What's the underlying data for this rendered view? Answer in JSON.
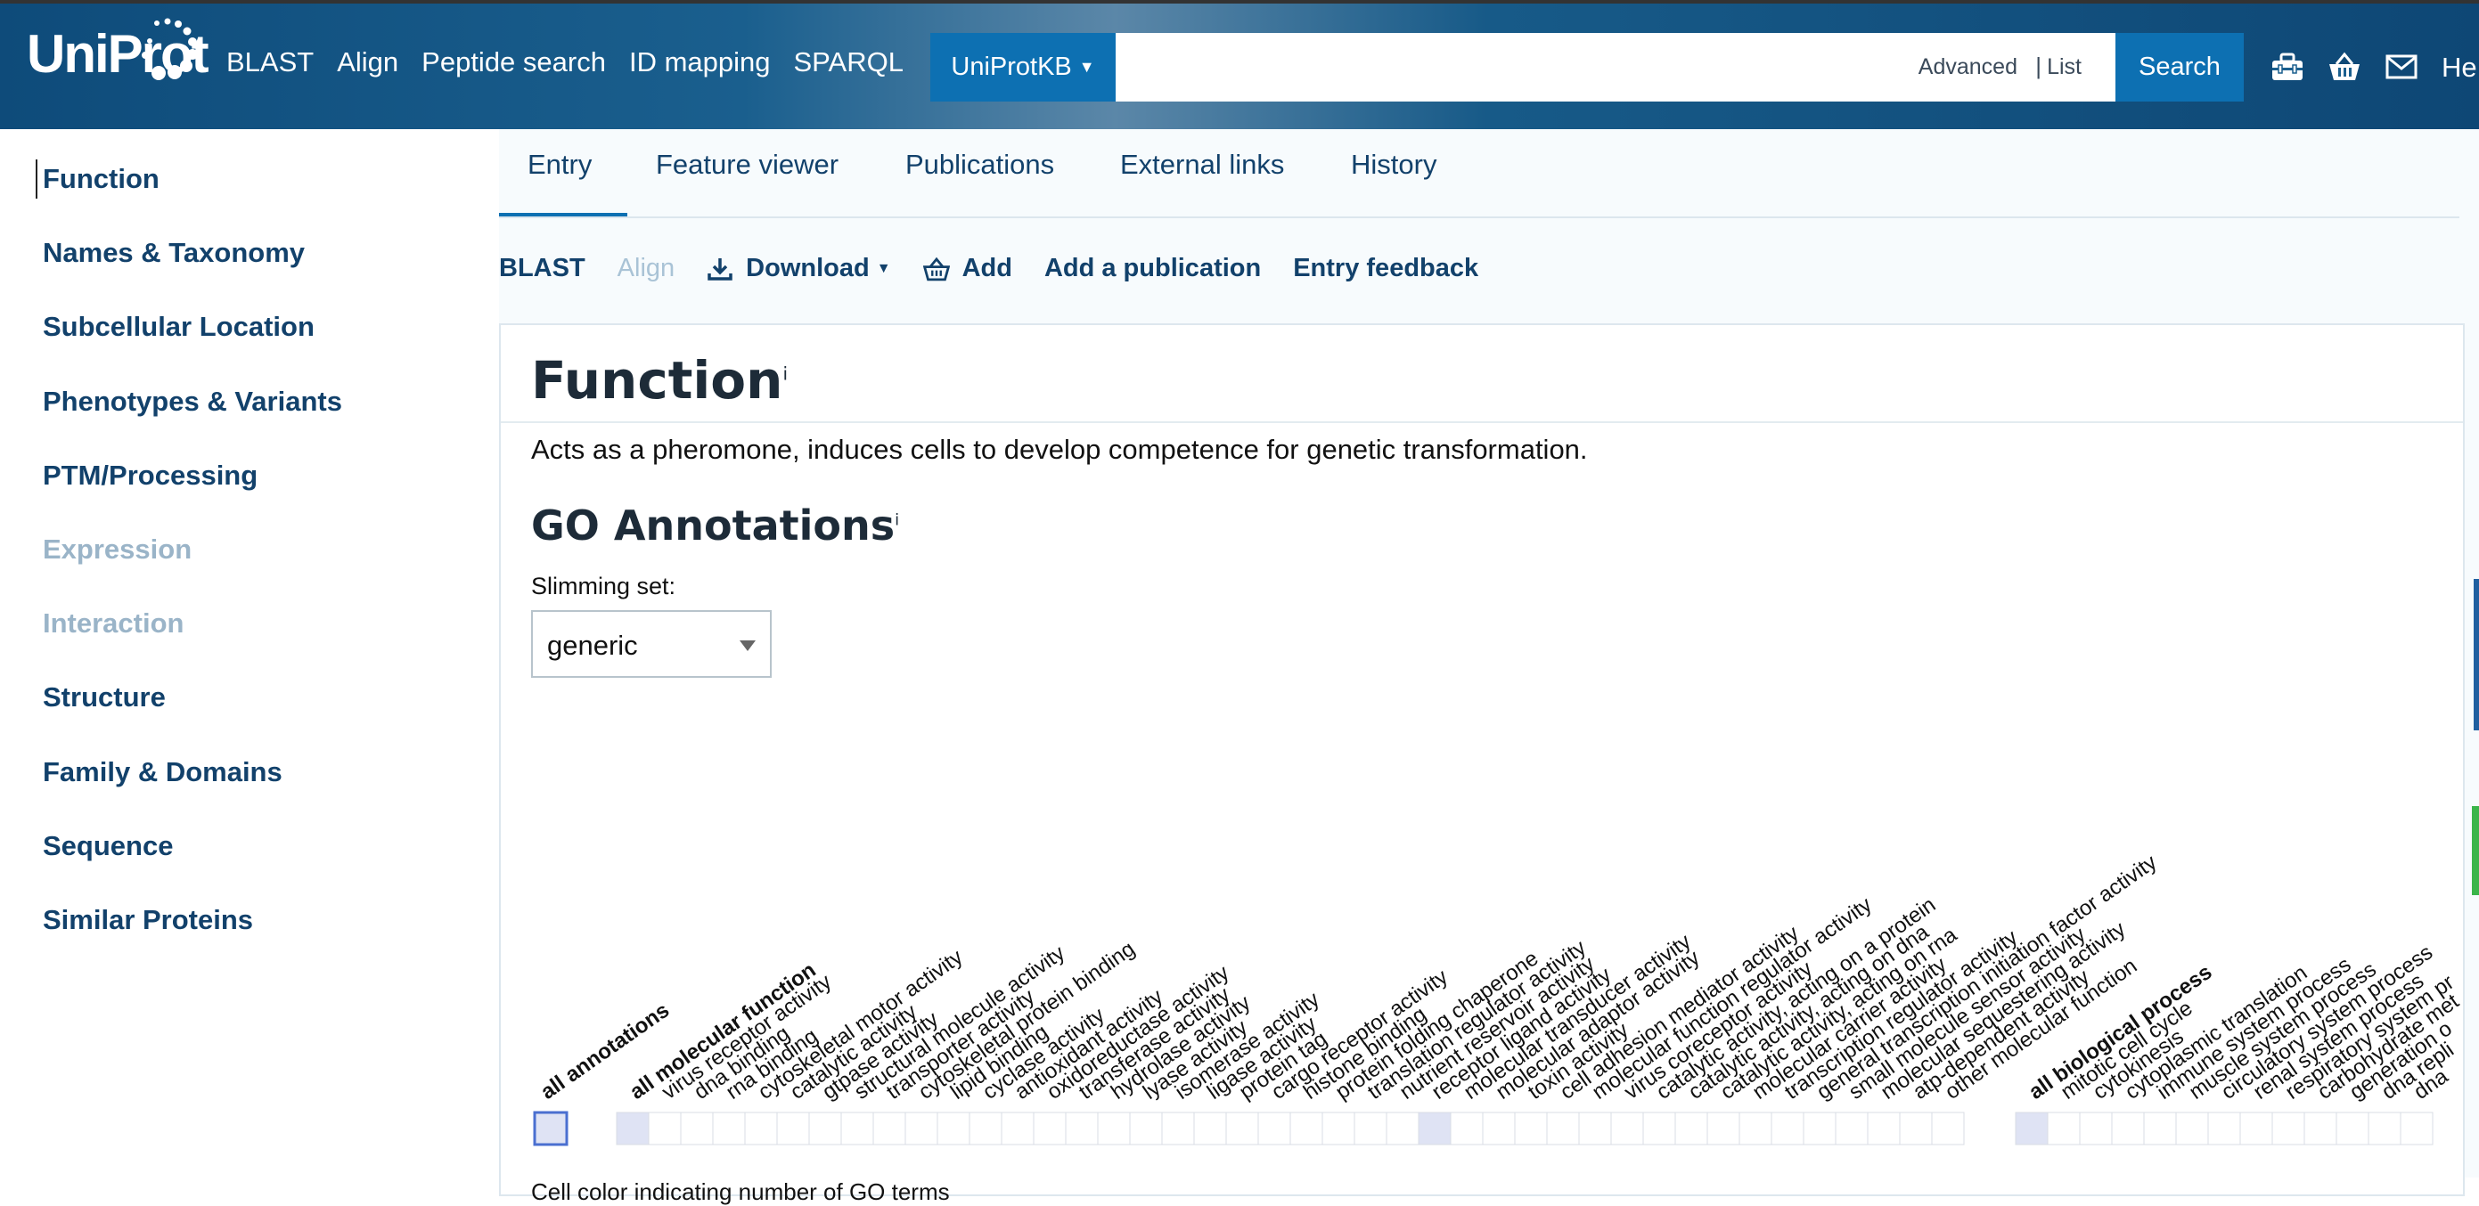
{
  "header": {
    "logo_text": "UniProt",
    "nav": [
      "BLAST",
      "Align",
      "Peptide search",
      "ID mapping",
      "SPARQL"
    ],
    "database": "UniProtKB",
    "search_placeholder": "",
    "advanced_label": "Advanced",
    "separator": "|",
    "list_label": "List",
    "search_label": "Search",
    "help_label": "He",
    "icons": [
      "toolbox-icon",
      "basket-icon",
      "mail-icon"
    ]
  },
  "sidebar": {
    "items": [
      {
        "label": "Function",
        "enabled": true
      },
      {
        "label": "Names & Taxonomy",
        "enabled": true
      },
      {
        "label": "Subcellular Location",
        "enabled": true
      },
      {
        "label": "Phenotypes & Variants",
        "enabled": true
      },
      {
        "label": "PTM/Processing",
        "enabled": true
      },
      {
        "label": "Expression",
        "enabled": false
      },
      {
        "label": "Interaction",
        "enabled": false
      },
      {
        "label": "Structure",
        "enabled": true
      },
      {
        "label": "Family & Domains",
        "enabled": true
      },
      {
        "label": "Sequence",
        "enabled": true
      },
      {
        "label": "Similar Proteins",
        "enabled": true
      }
    ]
  },
  "tabs": [
    "Entry",
    "Feature viewer",
    "Publications",
    "External links",
    "History"
  ],
  "actions": {
    "blast": "BLAST",
    "align": "Align",
    "download": "Download",
    "add": "Add",
    "add_publication": "Add a publication",
    "feedback": "Entry feedback"
  },
  "function_section": {
    "title": "Function",
    "info": "i",
    "description": "Acts as a pheromone, induces cells to develop competence for genetic transformation."
  },
  "go_section": {
    "title": "GO Annotations",
    "info": "i",
    "slimming_label": "Slimming set:",
    "slimming_value": "generic",
    "footer_text": "Cell color indicating number of GO terms"
  },
  "ribbon": {
    "all_label": "all annotations",
    "groups": [
      {
        "header": "all molecular function",
        "terms": [
          "virus receptor activity",
          "dna binding",
          "rna binding",
          "cytoskeletal motor activity",
          "catalytic activity",
          "gtpase activity",
          "structural molecule activity",
          "transporter activity",
          "cytoskeletal protein binding",
          "lipid binding",
          "cyclase activity",
          "antioxidant activity",
          "oxidoreductase activity",
          "transferase activity",
          "hydrolase activity",
          "lyase activity",
          "isomerase activity",
          "ligase activity",
          "protein tag",
          "cargo receptor activity",
          "histone binding",
          "protein folding chaperone",
          "translation regulator activity",
          "nutrient reservoir activity",
          "receptor ligand activity",
          "molecular transducer activity",
          "molecular adaptor activity",
          "toxin activity",
          "cell adhesion mediator activity",
          "molecular function regulator activity",
          "virus coreceptor activity",
          "catalytic activity, acting on a protein",
          "catalytic activity, acting on dna",
          "catalytic activity, acting on rna",
          "molecular carrier activity",
          "transcription regulator activity",
          "general transcription initiation factor activity",
          "small molecule sensor activity",
          "molecular sequestering activity",
          "atp-dependent activity",
          "other molecular function"
        ],
        "filled": [
          0,
          25
        ]
      },
      {
        "header": "all biological process",
        "terms": [
          "mitotic cell cycle",
          "cytokinesis",
          "cytoplasmic translation",
          "immune system process",
          "muscle system process",
          "circulatory system process",
          "renal system process",
          "respiratory system pr",
          "carbohydrate met",
          "generation o",
          "dna repli",
          "dna"
        ],
        "filled": [
          0
        ]
      }
    ]
  }
}
